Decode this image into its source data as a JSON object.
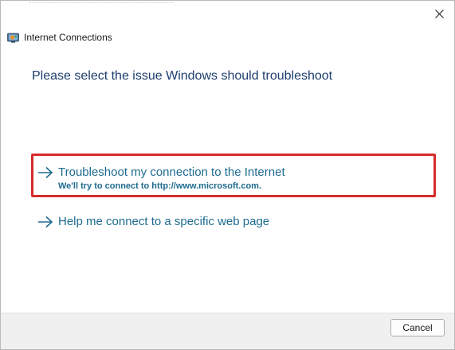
{
  "window": {
    "title": "Internet Connections",
    "app_icon": "network-connections-icon",
    "close_icon": "close-icon"
  },
  "main": {
    "heading": "Please select the issue Windows should troubleshoot",
    "options": [
      {
        "title": "Troubleshoot my connection to the Internet",
        "subtitle": "We'll try to connect to http://www.microsoft.com.",
        "icon": "arrow-right-icon",
        "highlighted": true
      },
      {
        "title": "Help me connect to a specific web page",
        "icon": "arrow-right-icon",
        "highlighted": false
      }
    ]
  },
  "footer": {
    "cancel_label": "Cancel"
  },
  "colors": {
    "link": "#1e6b8f",
    "heading": "#1c3d6e",
    "highlight_border": "#d62c2c",
    "footer_bg": "#f0f0f0"
  }
}
